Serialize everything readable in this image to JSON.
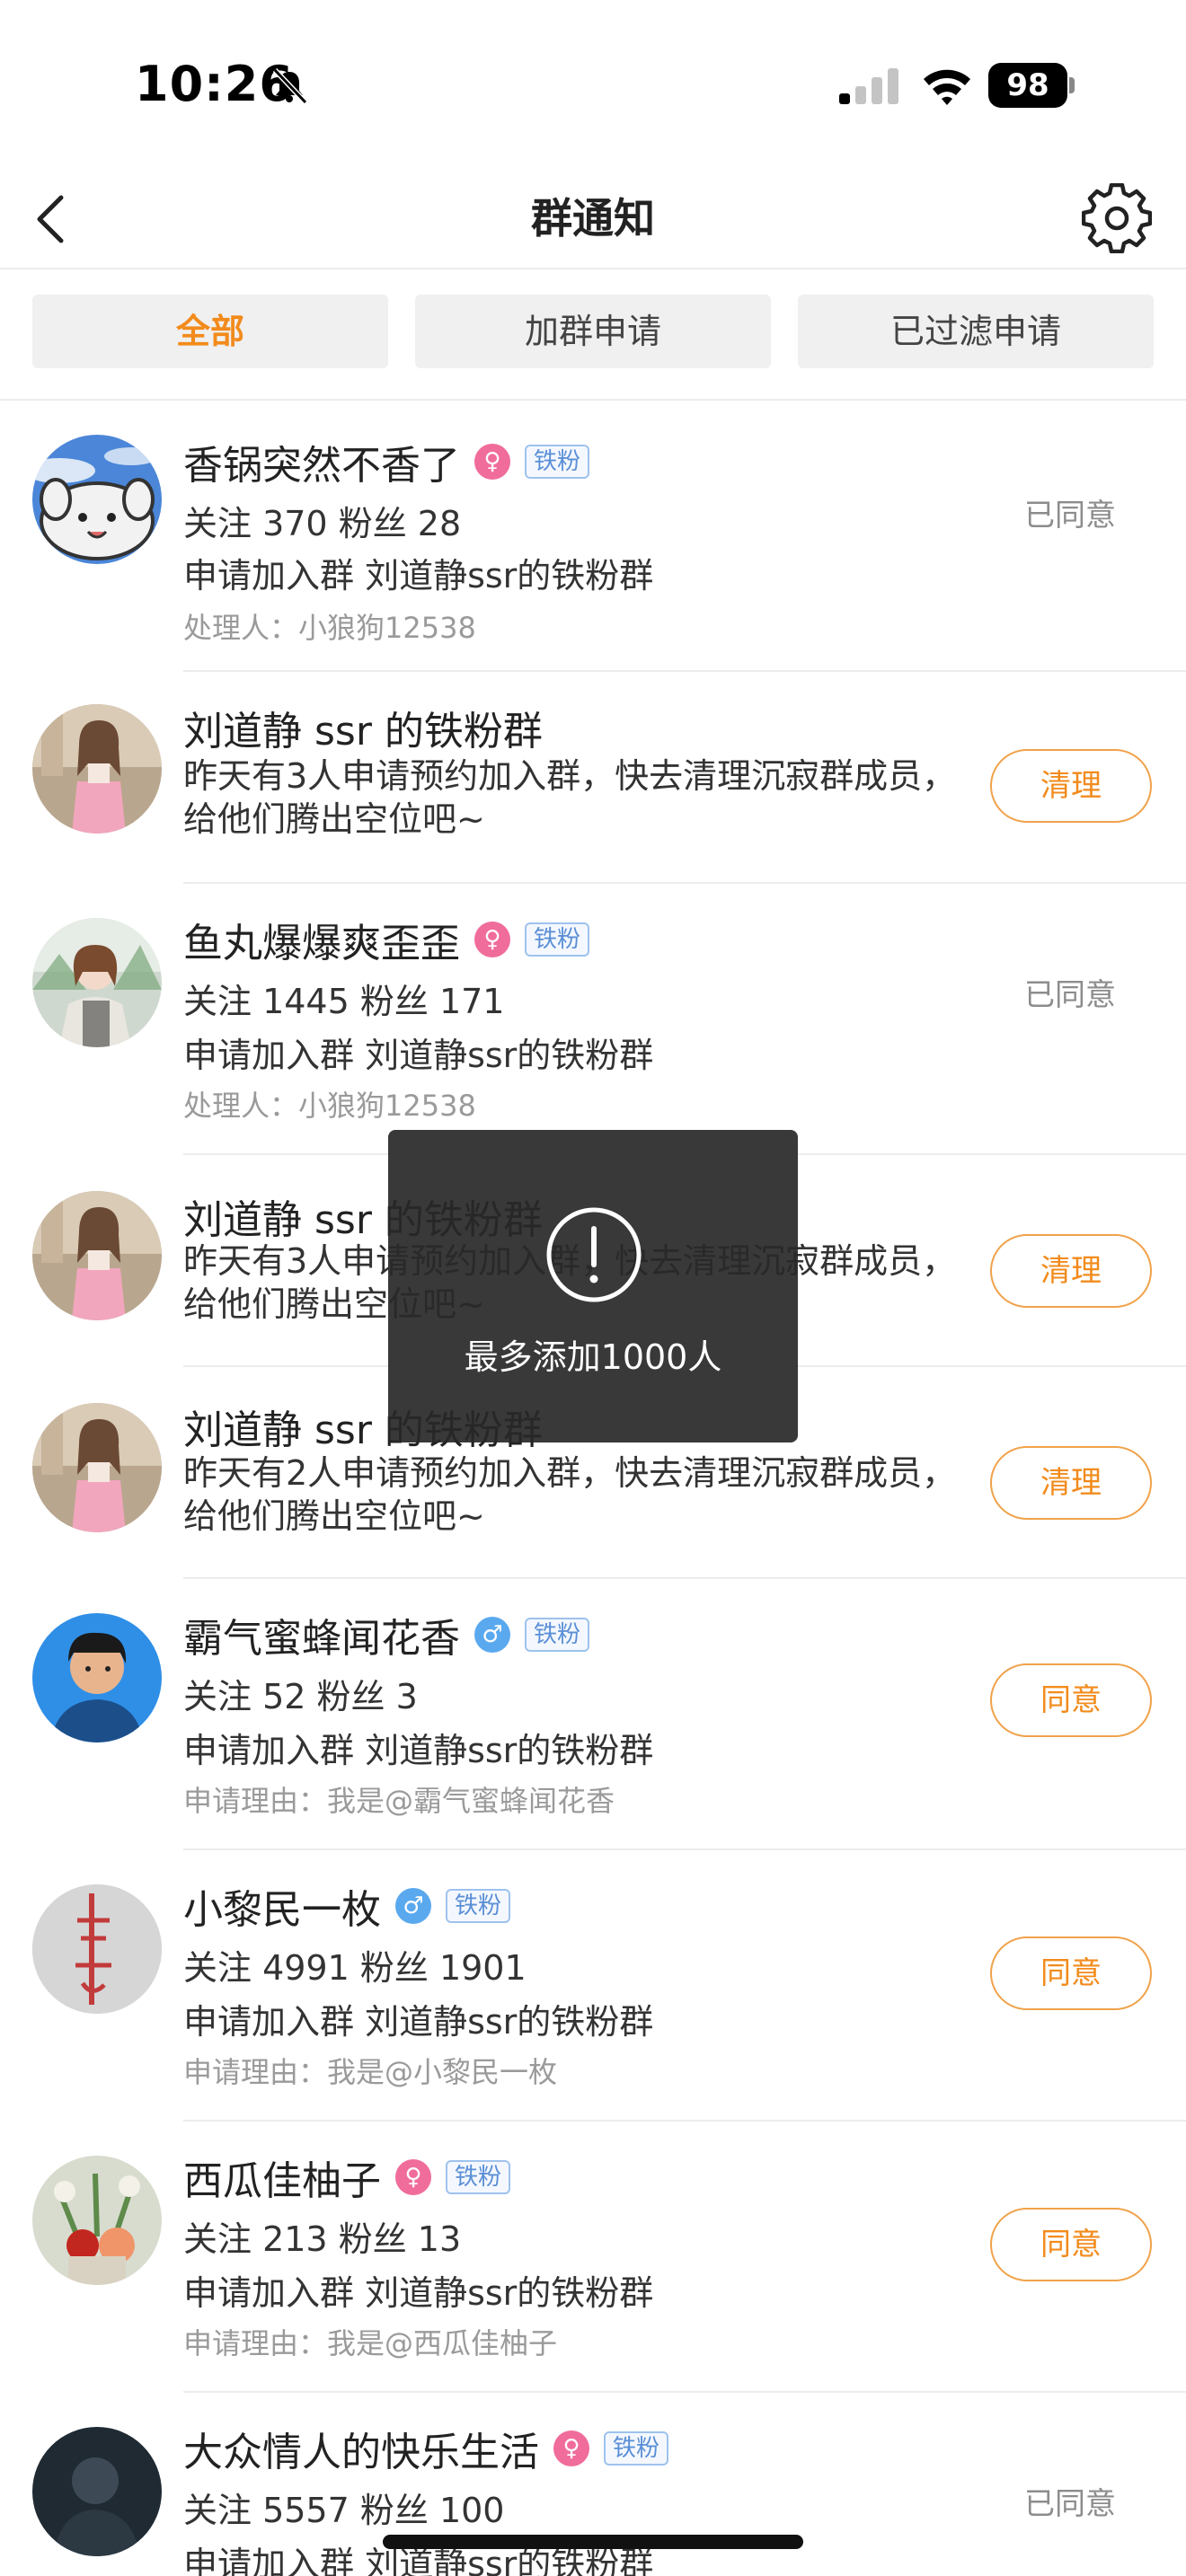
{
  "status_bar": {
    "time": "10:26",
    "battery": "98"
  },
  "nav": {
    "title": "群通知"
  },
  "tabs": [
    {
      "label": "全部",
      "active": true
    },
    {
      "label": "加群申请",
      "active": false
    },
    {
      "label": "已过滤申请",
      "active": false
    }
  ],
  "items": [
    {
      "name": "香锅突然不香了",
      "gender": "female",
      "badge": "铁粉",
      "stats": "关注 370  粉丝 28",
      "message": "申请加入群 刘道静ssr的铁粉群",
      "note": "处理人：小狼狗12538",
      "status": "已同意"
    },
    {
      "name": "刘道静 ssr 的铁粉群",
      "message": "昨天有3人申请预约加入群，快去清理沉寂群成员，给他们腾出空位吧~",
      "action": "清理"
    },
    {
      "name": "鱼丸爆爆爽歪歪",
      "gender": "female",
      "badge": "铁粉",
      "stats": "关注 1445  粉丝 171",
      "message": "申请加入群 刘道静ssr的铁粉群",
      "note": "处理人：小狼狗12538",
      "status": "已同意"
    },
    {
      "name": "刘道静 ssr 的铁粉群",
      "message": "昨天有3人申请预约加入群，快去清理沉寂群成员，给他们腾出空位吧~",
      "action": "清理"
    },
    {
      "name": "刘道静 ssr 的铁粉群",
      "message": "昨天有2人申请预约加入群，快去清理沉寂群成员，给他们腾出空位吧~",
      "action": "清理"
    },
    {
      "name": "霸气蜜蜂闻花香",
      "gender": "male",
      "badge": "铁粉",
      "stats": "关注 52  粉丝 3",
      "message": "申请加入群 刘道静ssr的铁粉群",
      "note": "申请理由：我是@霸气蜜蜂闻花香",
      "action": "同意"
    },
    {
      "name": "小黎民一枚",
      "gender": "male",
      "badge": "铁粉",
      "stats": "关注 4991  粉丝 1901",
      "message": "申请加入群 刘道静ssr的铁粉群",
      "note": "申请理由：我是@小黎民一枚",
      "action": "同意"
    },
    {
      "name": "西瓜佳柚子",
      "gender": "female",
      "badge": "铁粉",
      "stats": "关注 213  粉丝 13",
      "message": "申请加入群 刘道静ssr的铁粉群",
      "note": "申请理由：我是@西瓜佳柚子",
      "action": "同意"
    },
    {
      "name": "大众情人的快乐生活",
      "gender": "female",
      "badge": "铁粉",
      "stats": "关注 5557  粉丝 100",
      "message": "申请加入群 刘道静ssr的铁粉群",
      "status": "已同意"
    }
  ],
  "toast": {
    "text": "最多添加1000人",
    "icon": "exclamation-icon"
  },
  "colors": {
    "accent": "#f28b1c",
    "female": "#f06c9b",
    "male": "#5aa9ef"
  }
}
